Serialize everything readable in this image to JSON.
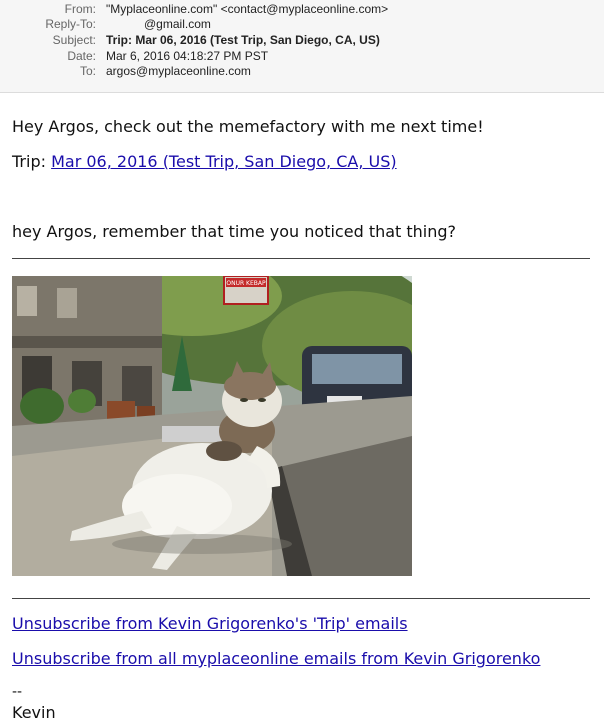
{
  "header": {
    "from_label": "From:",
    "from_value": "\"Myplaceonline.com\" <contact@myplaceonline.com>",
    "replyto_label": "Reply-To:",
    "replyto_value": "@gmail.com",
    "subject_label": "Subject:",
    "subject_value": "Trip: Mar 06, 2016 (Test Trip, San Diego, CA, US)",
    "date_label": "Date:",
    "date_value": "Mar 6, 2016 04:18:27 PM PST",
    "to_label": "To:",
    "to_value": "argos@myplaceonline.com"
  },
  "message": {
    "greeting": "Hey Argos, check out the memefactory with me next time!",
    "trip_prefix": "Trip: ",
    "trip_link": "Mar 06, 2016 (Test Trip, San Diego, CA, US)",
    "note": "hey Argos, remember that time you noticed that thing?",
    "photo_sign_text": "ONUR KEBAP",
    "unsubscribe_trip": "Unsubscribe from Kevin Grigorenko's 'Trip' emails",
    "unsubscribe_all": "Unsubscribe from all myplaceonline emails from Kevin Grigorenko",
    "sig_dashes": "--",
    "sig_name": "Kevin"
  }
}
